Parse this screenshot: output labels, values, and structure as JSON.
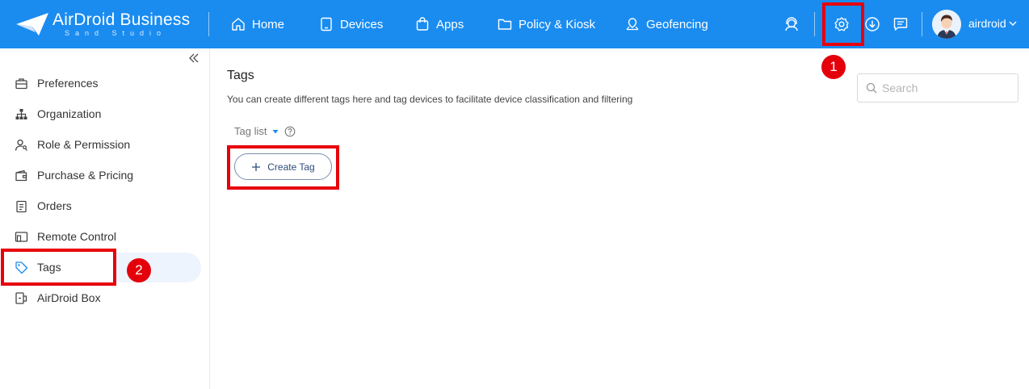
{
  "header": {
    "logo_name": "AirDroid Business",
    "logo_sub": "Sand Studio",
    "nav": [
      {
        "label": "Home",
        "icon": "home-icon"
      },
      {
        "label": "Devices",
        "icon": "device-icon"
      },
      {
        "label": "Apps",
        "icon": "apps-bag-icon"
      },
      {
        "label": "Policy & Kiosk",
        "icon": "folder-icon"
      },
      {
        "label": "Geofencing",
        "icon": "map-pin-icon"
      }
    ],
    "username": "airdroid",
    "bg_color": "#1a8cf0"
  },
  "annotations": {
    "badge1": "1",
    "badge2": "2",
    "highlight_color": "#e8000b"
  },
  "sidebar": {
    "items": [
      {
        "label": "Preferences",
        "icon": "briefcase-icon"
      },
      {
        "label": "Organization",
        "icon": "org-chart-icon"
      },
      {
        "label": "Role & Permission",
        "icon": "user-key-icon"
      },
      {
        "label": "Purchase & Pricing",
        "icon": "wallet-icon"
      },
      {
        "label": "Orders",
        "icon": "clipboard-icon"
      },
      {
        "label": "Remote Control",
        "icon": "remote-control-icon"
      },
      {
        "label": "Tags",
        "icon": "tag-icon",
        "active": true
      },
      {
        "label": "AirDroid Box",
        "icon": "box-device-icon"
      }
    ]
  },
  "main": {
    "title": "Tags",
    "description": "You can create different tags here and tag devices to facilitate device classification and filtering",
    "tag_list_label": "Tag list",
    "create_button": "Create Tag",
    "search_placeholder": "Search"
  }
}
